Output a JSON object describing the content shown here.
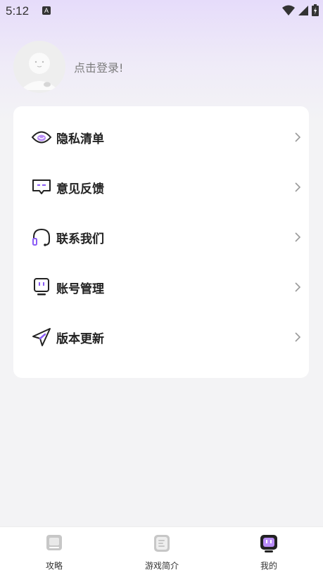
{
  "status_bar": {
    "time": "5:12",
    "notification_icon": "A",
    "icons": [
      "wifi-icon",
      "signal-icon",
      "battery-icon"
    ]
  },
  "profile": {
    "avatar_icon": "avatar-icon",
    "login_text": "点击登录!"
  },
  "menu": {
    "items": [
      {
        "label": "隐私清单",
        "icon": "privacy-icon"
      },
      {
        "label": "意见反馈",
        "icon": "feedback-icon"
      },
      {
        "label": "联系我们",
        "icon": "headset-icon"
      },
      {
        "label": "账号管理",
        "icon": "account-icon"
      },
      {
        "label": "版本更新",
        "icon": "send-icon"
      }
    ]
  },
  "tabbar": {
    "tabs": [
      {
        "label": "攻略",
        "icon": "book-icon",
        "active": false
      },
      {
        "label": "游戏简介",
        "icon": "document-icon",
        "active": false
      },
      {
        "label": "我的",
        "icon": "profile-icon",
        "active": true
      }
    ]
  },
  "colors": {
    "accent": "#8b5cf6",
    "accent_light": "#c4a6ff",
    "text_primary": "#222222",
    "text_secondary": "#7c7c7c"
  }
}
